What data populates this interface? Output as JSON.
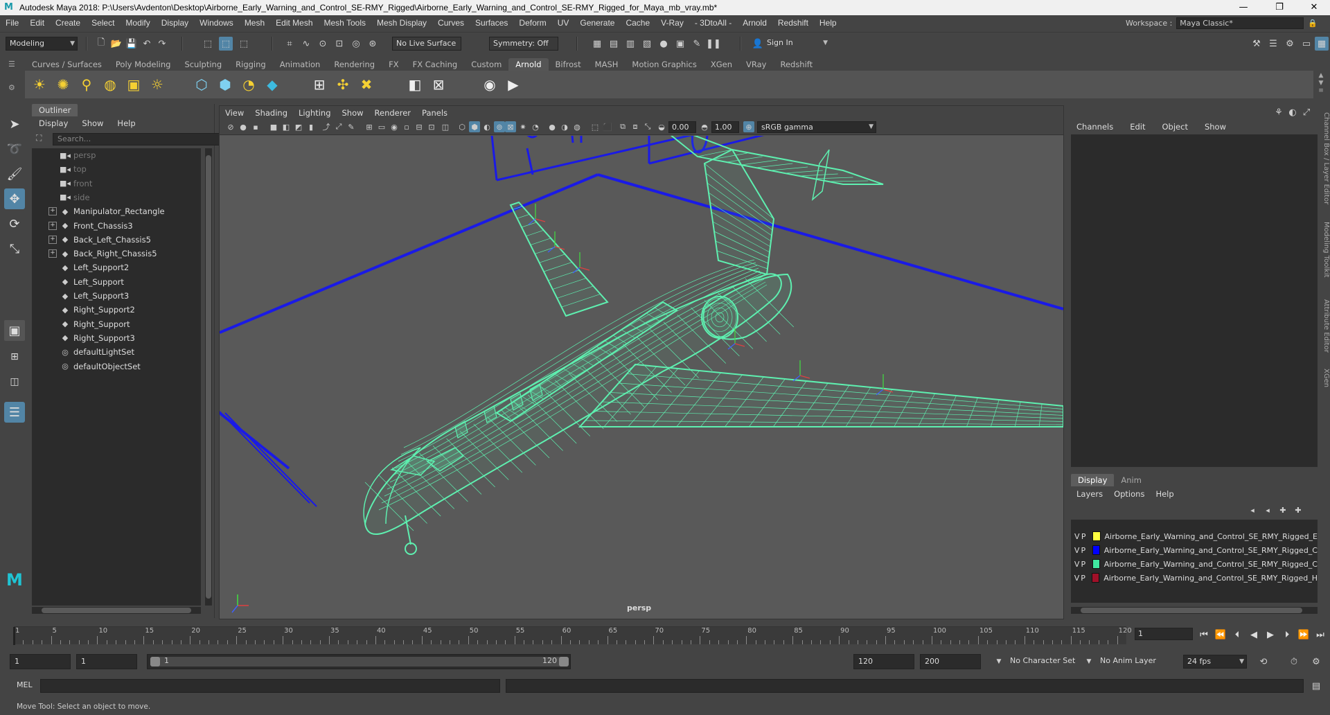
{
  "window": {
    "title": "Autodesk Maya 2018: P:\\Users\\Avdenton\\Desktop\\Airborne_Early_Warning_and_Control_SE-RMY_Rigged\\Airborne_Early_Warning_and_Control_SE-RMY_Rigged_for_Maya_mb_vray.mb*",
    "logo": "M",
    "minimize": "—",
    "maximize": "❐",
    "close": "✕"
  },
  "menubar": [
    "File",
    "Edit",
    "Create",
    "Select",
    "Modify",
    "Display",
    "Windows",
    "Mesh",
    "Edit Mesh",
    "Mesh Tools",
    "Mesh Display",
    "Curves",
    "Surfaces",
    "Deform",
    "UV",
    "Generate",
    "Cache",
    "V-Ray",
    "- 3DtoAll -",
    "Arnold",
    "Redshift",
    "Help"
  ],
  "workspace": {
    "label": "Workspace :",
    "value": "Maya Classic*"
  },
  "statusline": {
    "mode": "Modeling",
    "live_surface": "No Live Surface",
    "symmetry": "Symmetry: Off",
    "sign_in": "Sign In"
  },
  "shelf": {
    "tabs": [
      "Curves / Surfaces",
      "Poly Modeling",
      "Sculpting",
      "Rigging",
      "Animation",
      "Rendering",
      "FX",
      "FX Caching",
      "Custom",
      "Arnold",
      "Bifrost",
      "MASH",
      "Motion Graphics",
      "XGen",
      "VRay",
      "Redshift"
    ],
    "active_tab": "Arnold"
  },
  "outliner": {
    "title": "Outliner",
    "menu": [
      "Display",
      "Show",
      "Help"
    ],
    "search_placeholder": "Search...",
    "items": [
      {
        "label": "persp",
        "icon": "camera-icon",
        "dim": true,
        "expandable": false
      },
      {
        "label": "top",
        "icon": "camera-icon",
        "dim": true,
        "expandable": false
      },
      {
        "label": "front",
        "icon": "camera-icon",
        "dim": true,
        "expandable": false
      },
      {
        "label": "side",
        "icon": "camera-icon",
        "dim": true,
        "expandable": false
      },
      {
        "label": "Manipulator_Rectangle",
        "icon": "transform-icon",
        "dim": false,
        "expandable": true
      },
      {
        "label": "Front_Chassis3",
        "icon": "transform-icon",
        "dim": false,
        "expandable": true
      },
      {
        "label": "Back_Left_Chassis5",
        "icon": "transform-icon",
        "dim": false,
        "expandable": true
      },
      {
        "label": "Back_Right_Chassis5",
        "icon": "transform-icon",
        "dim": false,
        "expandable": true
      },
      {
        "label": "Left_Support2",
        "icon": "transform-icon",
        "dim": false,
        "expandable": false
      },
      {
        "label": "Left_Support",
        "icon": "transform-icon",
        "dim": false,
        "expandable": false
      },
      {
        "label": "Left_Support3",
        "icon": "transform-icon",
        "dim": false,
        "expandable": false
      },
      {
        "label": "Right_Support2",
        "icon": "transform-icon",
        "dim": false,
        "expandable": false
      },
      {
        "label": "Right_Support",
        "icon": "transform-icon",
        "dim": false,
        "expandable": false
      },
      {
        "label": "Right_Support3",
        "icon": "transform-icon",
        "dim": false,
        "expandable": false
      },
      {
        "label": "defaultLightSet",
        "icon": "set-icon",
        "dim": false,
        "expandable": false
      },
      {
        "label": "defaultObjectSet",
        "icon": "set-icon",
        "dim": false,
        "expandable": false
      }
    ]
  },
  "viewport": {
    "menu": [
      "View",
      "Shading",
      "Lighting",
      "Show",
      "Renderer",
      "Panels"
    ],
    "exposure": "0.00",
    "gamma": "1.00",
    "color_space": "sRGB gamma",
    "camera_label": "persp",
    "wire_color": "#5ef0b0",
    "rig_color": "#1a1ae6"
  },
  "channelbox": {
    "menu": [
      "Channels",
      "Edit",
      "Object",
      "Show"
    ],
    "layer_tabs": [
      "Display",
      "Anim"
    ],
    "active_layer_tab": "Display",
    "layer_menu": [
      "Layers",
      "Options",
      "Help"
    ],
    "layers": [
      {
        "v": "V",
        "p": "P",
        "color": "#ffff40",
        "name": "Airborne_Early_Warning_and_Control_SE_RMY_Rigged_E"
      },
      {
        "v": "V",
        "p": "P",
        "color": "#0000ff",
        "name": "Airborne_Early_Warning_and_Control_SE_RMY_Rigged_C"
      },
      {
        "v": "V",
        "p": "P",
        "color": "#40e8a0",
        "name": "Airborne_Early_Warning_and_Control_SE_RMY_Rigged_C"
      },
      {
        "v": "V",
        "p": "P",
        "color": "#a01028",
        "name": "Airborne_Early_Warning_and_Control_SE_RMY_Rigged_H"
      }
    ],
    "side_tabs": [
      "Channel Box / Layer Editor",
      "Modeling Toolkit",
      "Attribute Editor",
      "XGen"
    ]
  },
  "timeline": {
    "ticks": [
      5,
      10,
      15,
      20,
      25,
      30,
      35,
      40,
      45,
      50,
      55,
      60,
      65,
      70,
      75,
      80,
      85,
      90,
      95,
      100,
      105,
      110,
      115,
      120
    ],
    "start_label": "1",
    "current_frame": "1"
  },
  "range": {
    "start": "1",
    "playback_start": "1",
    "slider_start": "1",
    "slider_end": "120",
    "playback_end": "120",
    "end": "200",
    "character_set": "No Character Set",
    "anim_layer": "No Anim Layer",
    "fps": "24 fps"
  },
  "cmdline": {
    "label": "MEL"
  },
  "helpline": {
    "text": "Move Tool: Select an object to move."
  }
}
